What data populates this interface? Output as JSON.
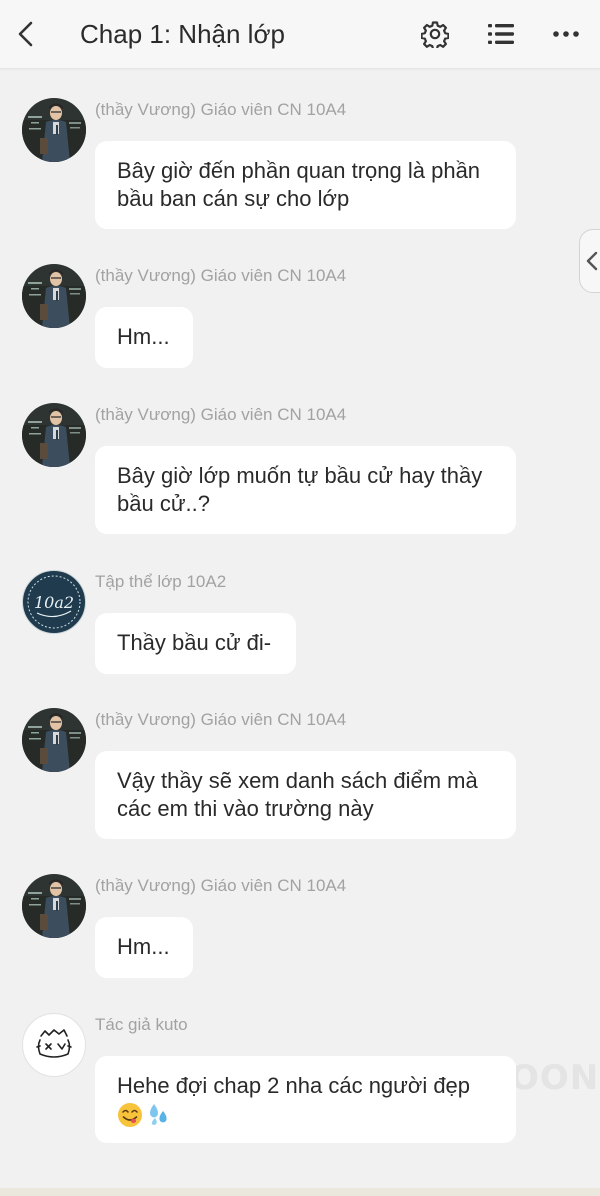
{
  "header": {
    "title": "Chap 1: Nhận lớp"
  },
  "messages": [
    {
      "sender": "(thầy Vương) Giáo viên CN 10A4",
      "avatar": "teacher",
      "lines": [
        "Bây giờ đến phần quan trọng là phần",
        "bầu ban cán sự cho lớp"
      ]
    },
    {
      "sender": "(thầy Vương) Giáo viên CN 10A4",
      "avatar": "teacher",
      "lines": [
        "Hm..."
      ]
    },
    {
      "sender": "(thầy Vương) Giáo viên CN 10A4",
      "avatar": "teacher",
      "lines": [
        "Bây giờ lớp muốn tự bầu cử hay thầy",
        "bầu cử..?"
      ]
    },
    {
      "sender": "Tập thể lớp 10A2",
      "avatar": "class",
      "avatar_text": "10a2",
      "lines": [
        "Thầy bầu cử đi-"
      ]
    },
    {
      "sender": "(thầy Vương) Giáo viên CN 10A4",
      "avatar": "teacher",
      "lines": [
        "Vậy thầy sẽ xem danh sách điểm mà",
        "các em thi vào trường này"
      ]
    },
    {
      "sender": "(thầy Vương) Giáo viên CN 10A4",
      "avatar": "teacher",
      "lines": [
        "Hm..."
      ]
    },
    {
      "sender": "Tác giả kuto",
      "avatar": "author",
      "lines": [
        "Hehe đợi chap 2 nha các người đẹp"
      ],
      "emojis": [
        "yum-face-emoji",
        "sweat-droplets-emoji"
      ]
    }
  ],
  "watermark": "OON",
  "colors": {
    "background": "#f1f1f1",
    "bubble": "#ffffff",
    "sender": "#a2a2a2",
    "class_avatar": "#1f3b4d"
  }
}
